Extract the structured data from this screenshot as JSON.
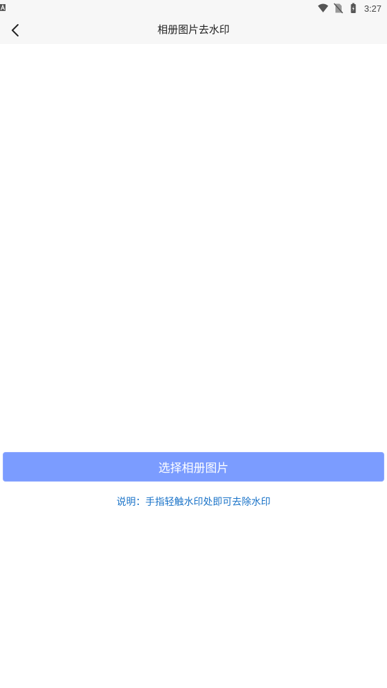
{
  "status_bar": {
    "time": "3:27",
    "icons": [
      "text-notification-icon",
      "wifi-icon",
      "no-sim-icon",
      "battery-charging-icon"
    ]
  },
  "header": {
    "title": "相册图片去水印",
    "back_icon": "chevron-left-icon"
  },
  "main": {
    "select_button_label": "选择相册图片",
    "hint": "说明：手指轻触水印处即可去除水印"
  },
  "colors": {
    "button_bg": "#7b9cff",
    "hint_text": "#1a73c8",
    "bar_bg": "#f7f7f7"
  }
}
